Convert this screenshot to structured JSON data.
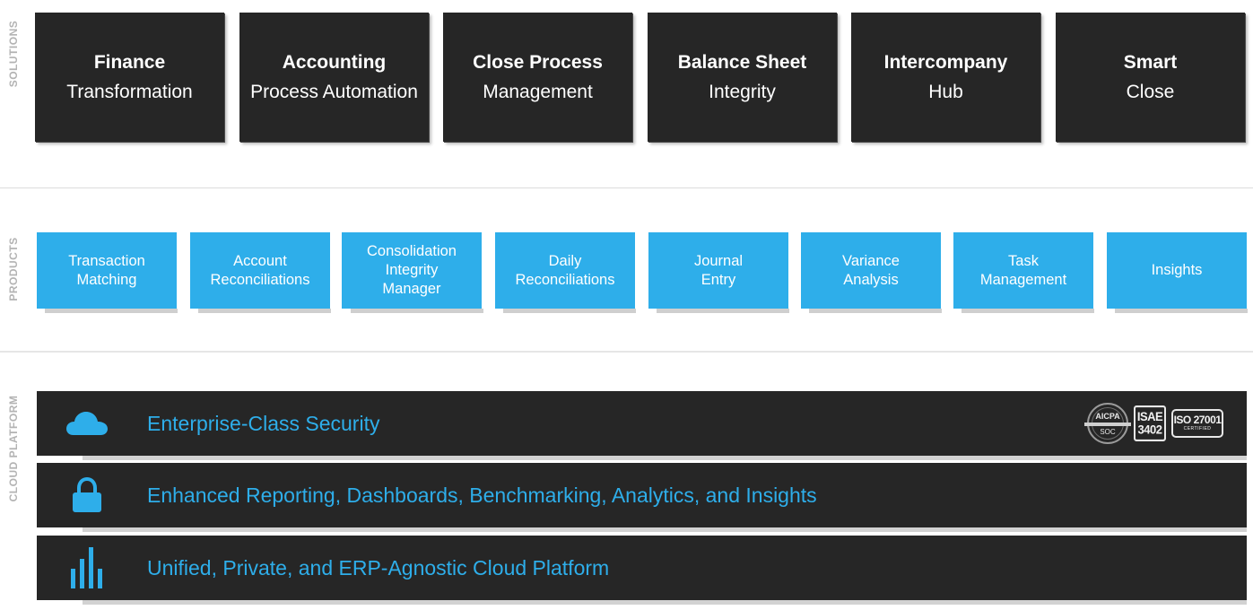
{
  "sections": {
    "solutions_label": "SOLUTIONS",
    "products_label": "PRODUCTS",
    "platform_label": "CLOUD PLATFORM"
  },
  "solutions": [
    {
      "title": "Finance",
      "subtitle": "Transformation"
    },
    {
      "title": "Accounting",
      "subtitle": "Process Automation"
    },
    {
      "title": "Close Process",
      "subtitle": "Management"
    },
    {
      "title": "Balance Sheet",
      "subtitle": "Integrity"
    },
    {
      "title": "Intercompany",
      "subtitle": "Hub"
    },
    {
      "title": "Smart",
      "subtitle": "Close"
    }
  ],
  "products": [
    {
      "label": "Transaction\nMatching"
    },
    {
      "label": "Account\nReconciliations"
    },
    {
      "label": "Consolidation\nIntegrity\nManager"
    },
    {
      "label": "Daily\nReconciliations"
    },
    {
      "label": "Journal\nEntry"
    },
    {
      "label": "Variance\nAnalysis"
    },
    {
      "label": "Task\nManagement"
    },
    {
      "label": "Insights"
    }
  ],
  "platform": [
    {
      "icon": "cloud-icon",
      "text": "Enterprise-Class Security"
    },
    {
      "icon": "lock-icon",
      "text": "Enhanced Reporting, Dashboards, Benchmarking, Analytics, and Insights"
    },
    {
      "icon": "bar-chart-icon",
      "text": "Unified, Private, and ERP-Agnostic Cloud Platform"
    }
  ],
  "certifications": {
    "soc": {
      "top": "AICPA",
      "bottom": "SOC"
    },
    "isae": {
      "line1": "ISAE",
      "line2": "3402"
    },
    "iso": {
      "main": "ISO 27001",
      "sub": "CERTIFIED"
    }
  },
  "colors": {
    "accent": "#2eaeea",
    "dark_card": "#262626",
    "label_gray": "#b3b3b3"
  }
}
